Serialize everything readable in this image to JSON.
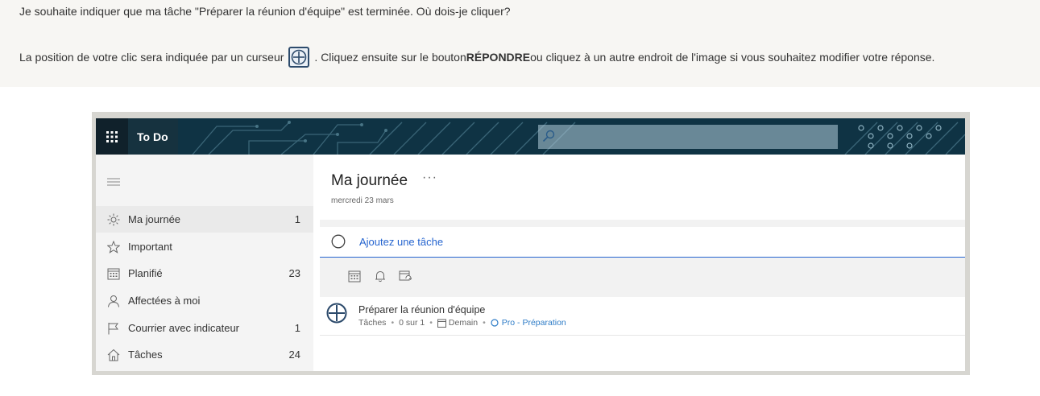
{
  "prompt": {
    "question": "Je souhaite indiquer que ma tâche \"Préparer la réunion d'équipe\" est terminée. Où dois-je cliquer?",
    "instruction_pre": "La position de votre clic sera indiquée par un curseur",
    "instruction_mid": ". Cliquez ensuite sur le bouton ",
    "instruction_bold": "RÉPONDRE",
    "instruction_post": " ou cliquez à un autre endroit de l'image si vous souhaitez modifier votre réponse."
  },
  "app": {
    "name": "To Do",
    "accent": "#2564cf",
    "header_bg": "#0f3344"
  },
  "sidebar": {
    "items": [
      {
        "label": "Ma journée",
        "count": "1",
        "icon": "sun-icon"
      },
      {
        "label": "Important",
        "count": "",
        "icon": "star-icon"
      },
      {
        "label": "Planifié",
        "count": "23",
        "icon": "calendar-icon"
      },
      {
        "label": "Affectées à moi",
        "count": "",
        "icon": "person-icon"
      },
      {
        "label": "Courrier avec indicateur",
        "count": "1",
        "icon": "flag-icon"
      },
      {
        "label": "Tâches",
        "count": "24",
        "icon": "home-icon"
      }
    ]
  },
  "main": {
    "title": "Ma journée",
    "more": "···",
    "date": "mercredi 23 mars",
    "add_task_placeholder": "Ajoutez une tâche",
    "task": {
      "title": "Préparer la réunion d'équipe",
      "list": "Tâches",
      "steps": "0 sur 1",
      "due": "Demain",
      "category": "Pro - Préparation"
    }
  }
}
